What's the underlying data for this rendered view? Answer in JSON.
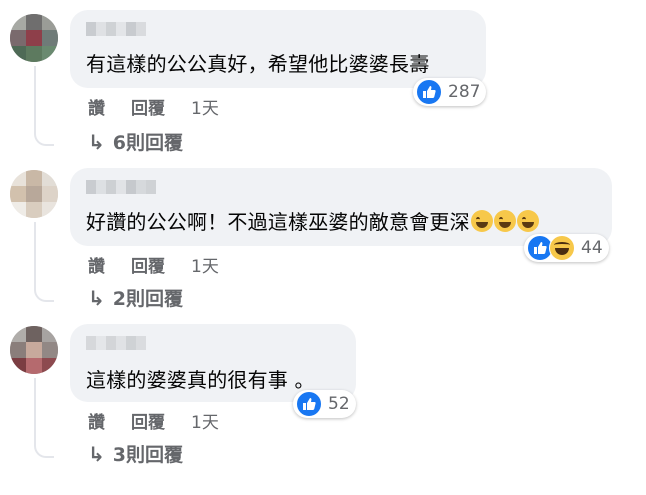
{
  "comments": [
    {
      "text": "有這樣的公公真好，希望他比婆婆長壽",
      "emojis": [],
      "reactions": [
        "like"
      ],
      "reaction_count": "287",
      "like_label": "讚",
      "reply_label": "回覆",
      "time": "1天",
      "replies_label": "6則回覆"
    },
    {
      "text": "好讚的公公啊！不過這樣巫婆的敵意會更深",
      "emojis": [
        "rolling-laughing-face",
        "rolling-laughing-face",
        "rolling-laughing-face"
      ],
      "reactions": [
        "like",
        "haha"
      ],
      "reaction_count": "44",
      "like_label": "讚",
      "reply_label": "回覆",
      "time": "1天",
      "replies_label": "2則回覆"
    },
    {
      "text": "這樣的婆婆真的很有事 。",
      "emojis": [],
      "reactions": [
        "like"
      ],
      "reaction_count": "52",
      "like_label": "讚",
      "reply_label": "回覆",
      "time": "1天",
      "replies_label": "3則回覆"
    }
  ],
  "reply_arrow_icon": "reply-arrow-icon",
  "colors": {
    "bubble": "#f0f2f5",
    "text": "#050505",
    "secondary": "#65676b",
    "like_blue": "#1877f2",
    "haha_yellow": "#f7c84a"
  }
}
